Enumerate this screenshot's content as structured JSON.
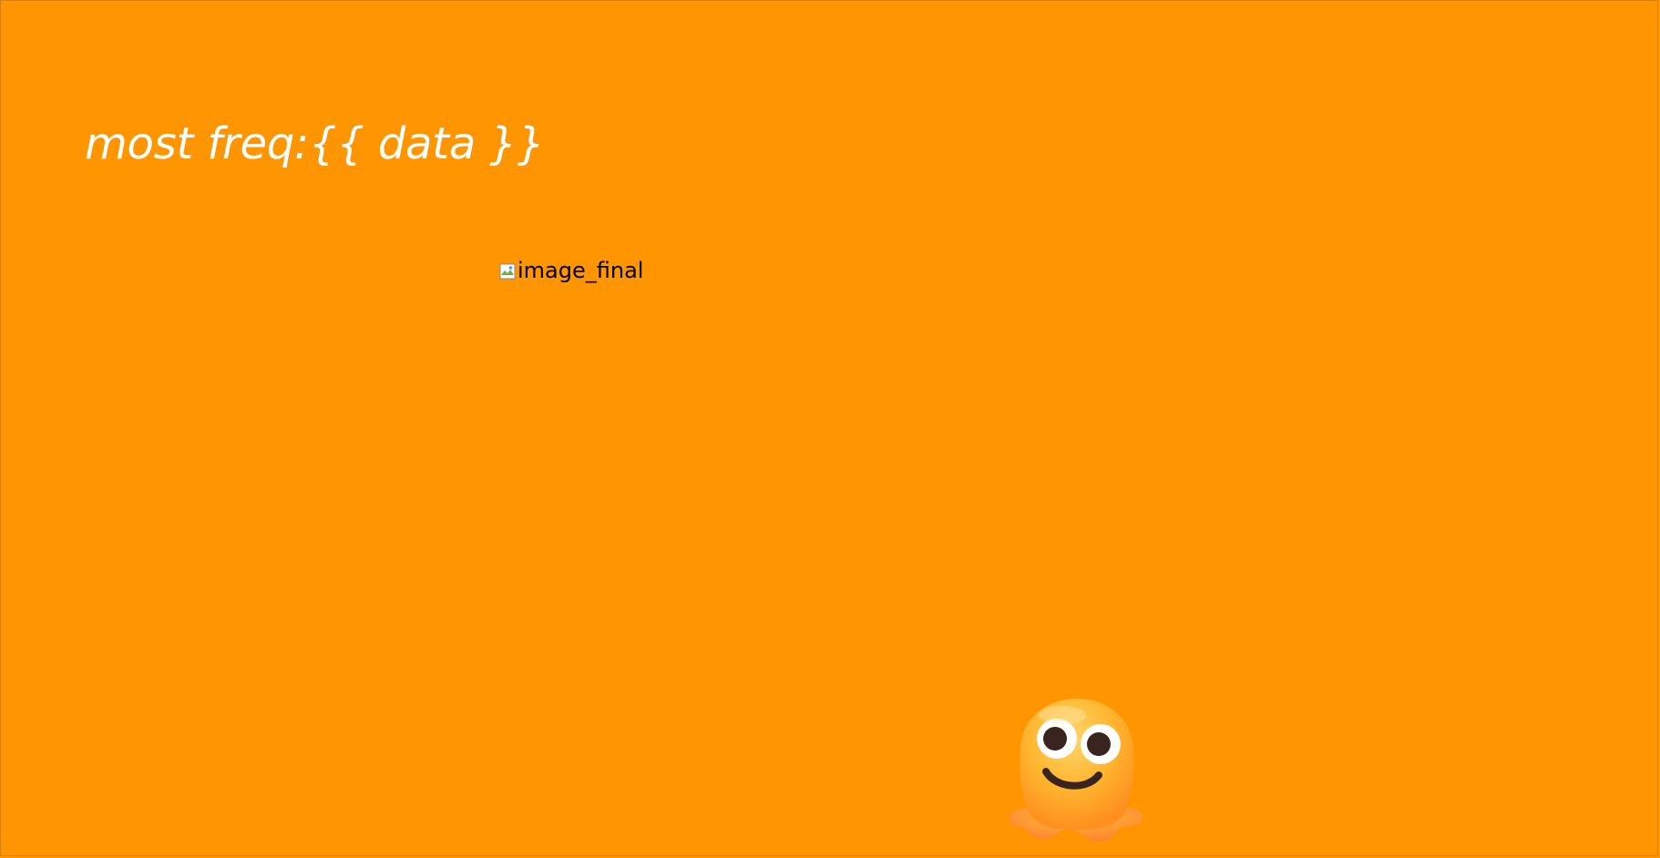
{
  "page": {
    "background_color": "#ff9500",
    "title": "most freq:{{ data }}",
    "broken_image_alt": "image_final",
    "mascot_icon": "melting-face-mascot-icon"
  }
}
